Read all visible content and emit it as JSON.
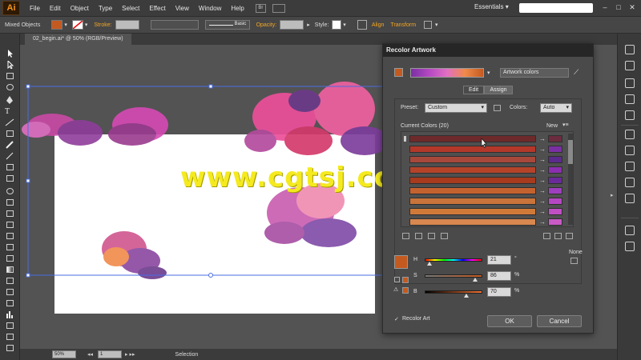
{
  "app": {
    "logo": "Ai",
    "menu": [
      "File",
      "Edit",
      "Object",
      "Type",
      "Select",
      "Effect",
      "View",
      "Window",
      "Help"
    ],
    "bridge_badge": "Br",
    "workspace": "Essentials",
    "window_buttons": [
      "–",
      "□",
      "✕"
    ]
  },
  "control_bar": {
    "selection_label": "Mixed Objects",
    "stroke_label": "Stroke:",
    "stroke_style": "Basic",
    "opacity_label": "Opacity:",
    "style_label": "Style:",
    "align_label": "Align",
    "transform_label": "Transform"
  },
  "document": {
    "tab_title": "02_begin.ai* @ 50% (RGB/Preview)"
  },
  "watermark": "www.cgtsj.com",
  "status_bar": {
    "zoom": "50%",
    "artboard": "1",
    "tool": "Selection"
  },
  "dialog": {
    "title": "Recolor Artwork",
    "artwork_colors": "Artwork colors",
    "tab_edit": "Edit",
    "tab_assign": "Assign",
    "preset_label": "Preset:",
    "preset_value": "Custom",
    "colors_label": "Colors:",
    "colors_value": "Auto",
    "current_colors_label": "Current Colors (20)",
    "new_label": "New",
    "none_label": "None",
    "rows": [
      {
        "current": "#6e2a2a",
        "new": "#6b2c3f"
      },
      {
        "current": "#b3382a",
        "new": "#7a2fa3"
      },
      {
        "current": "#a8483a",
        "new": "#5b2a8c"
      },
      {
        "current": "#b5432a",
        "new": "#8b2fb0"
      },
      {
        "current": "#a83a1e",
        "new": "#6a2a9a"
      },
      {
        "current": "#c4622f",
        "new": "#9d3fbf"
      },
      {
        "current": "#c8743a",
        "new": "#b548c2"
      },
      {
        "current": "#d07a3a",
        "new": "#c04fc4"
      },
      {
        "current": "#d98850",
        "new": "#c95ac6"
      }
    ],
    "h_label": "H",
    "h_value": "21",
    "h_unit": "°",
    "s_label": "S",
    "s_value": "86",
    "s_unit": "%",
    "b_label": "B",
    "b_value": "70",
    "b_unit": "%",
    "recolor_art_label": "Recolor Art",
    "recolor_art_check": "✓",
    "ok": "OK",
    "cancel": "Cancel",
    "base_color": "#c45a1f"
  }
}
